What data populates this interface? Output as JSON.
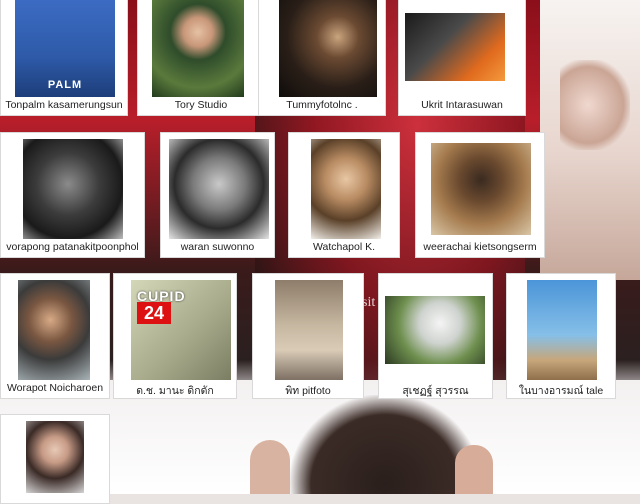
{
  "people": [
    {
      "name": "Tonpalm kasamerungsun",
      "photo_text": "PALM"
    },
    {
      "name": "Tory Studio"
    },
    {
      "name": "Tummyfotolnc ."
    },
    {
      "name": "Ukrit Intarasuwan"
    },
    {
      "name": "vorapong patanakitpoonphol"
    },
    {
      "name": "waran suwonno"
    },
    {
      "name": "Watchapol K."
    },
    {
      "name": "weerachai kietsongserm"
    },
    {
      "name": "Worapot Noicharoen"
    },
    {
      "name": "ด.ช. มานะ ดิกดัก",
      "photo_text": "CUPID",
      "photo_number": "24"
    },
    {
      "name": "พิท pitfoto"
    },
    {
      "name": "สุเชฏฐ์ สุวรรณ"
    },
    {
      "name": "ในบางอารมณ์ tale"
    },
    {
      "name": ""
    }
  ],
  "background": {
    "overlay_text": "sit"
  }
}
